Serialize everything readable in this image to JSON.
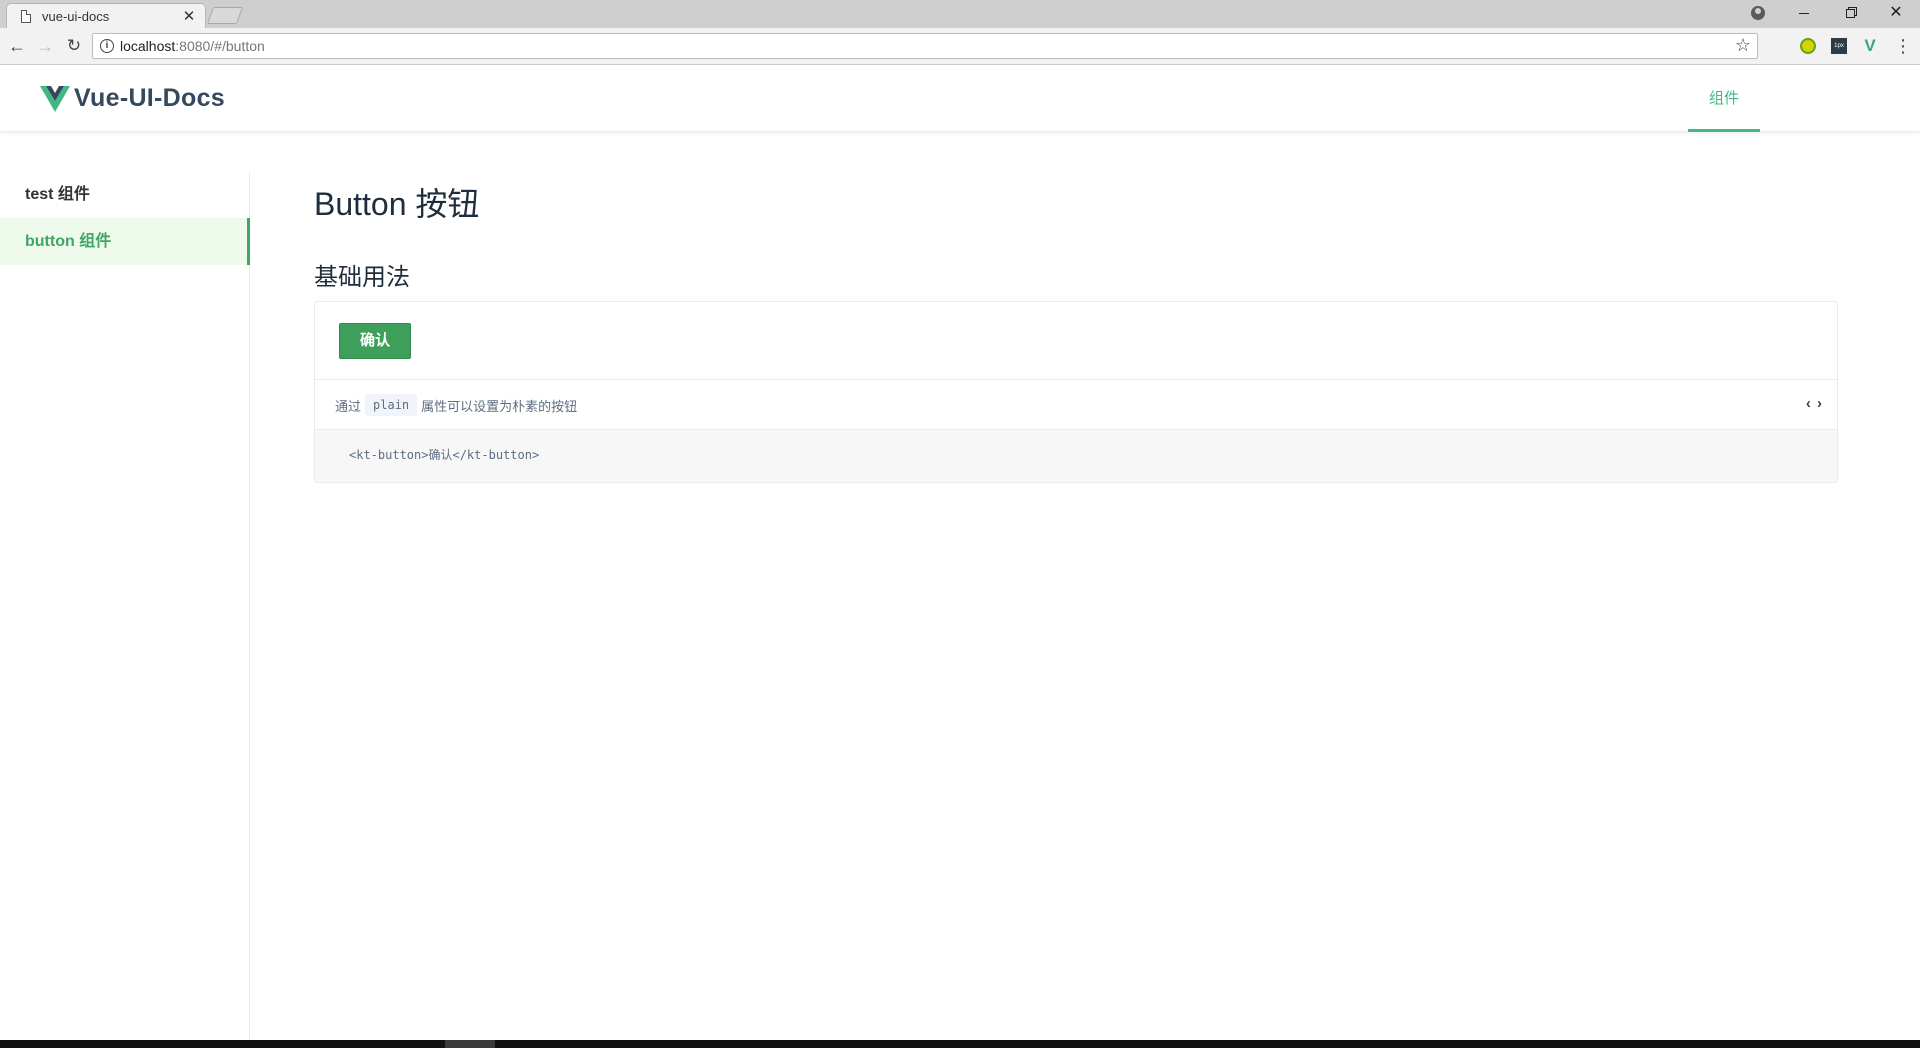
{
  "browser": {
    "tab_title": "vue-ui-docs",
    "url_host": "localhost",
    "url_rest": ":8080/#/button",
    "ext_2_label": "1px"
  },
  "header": {
    "logo_text": "Vue-UI-Docs",
    "nav_items": [
      {
        "label": "组件",
        "active": true
      }
    ]
  },
  "sidebar": {
    "items": [
      {
        "label": "test 组件",
        "active": false
      },
      {
        "label": "button 组件",
        "active": true
      }
    ]
  },
  "main": {
    "title": "Button 按钮",
    "section_title": "基础用法",
    "demo": {
      "button_label": "确认",
      "desc_prefix": "通过",
      "desc_code": "plain",
      "desc_suffix": "属性可以设置为朴素的按钮",
      "code": "<kt-button>确认</kt-button>",
      "toggle_symbol": "‹ ›"
    }
  },
  "colors": {
    "accent": "#42b983",
    "button": "#3e9f5a",
    "logo_text": "#35495e"
  }
}
